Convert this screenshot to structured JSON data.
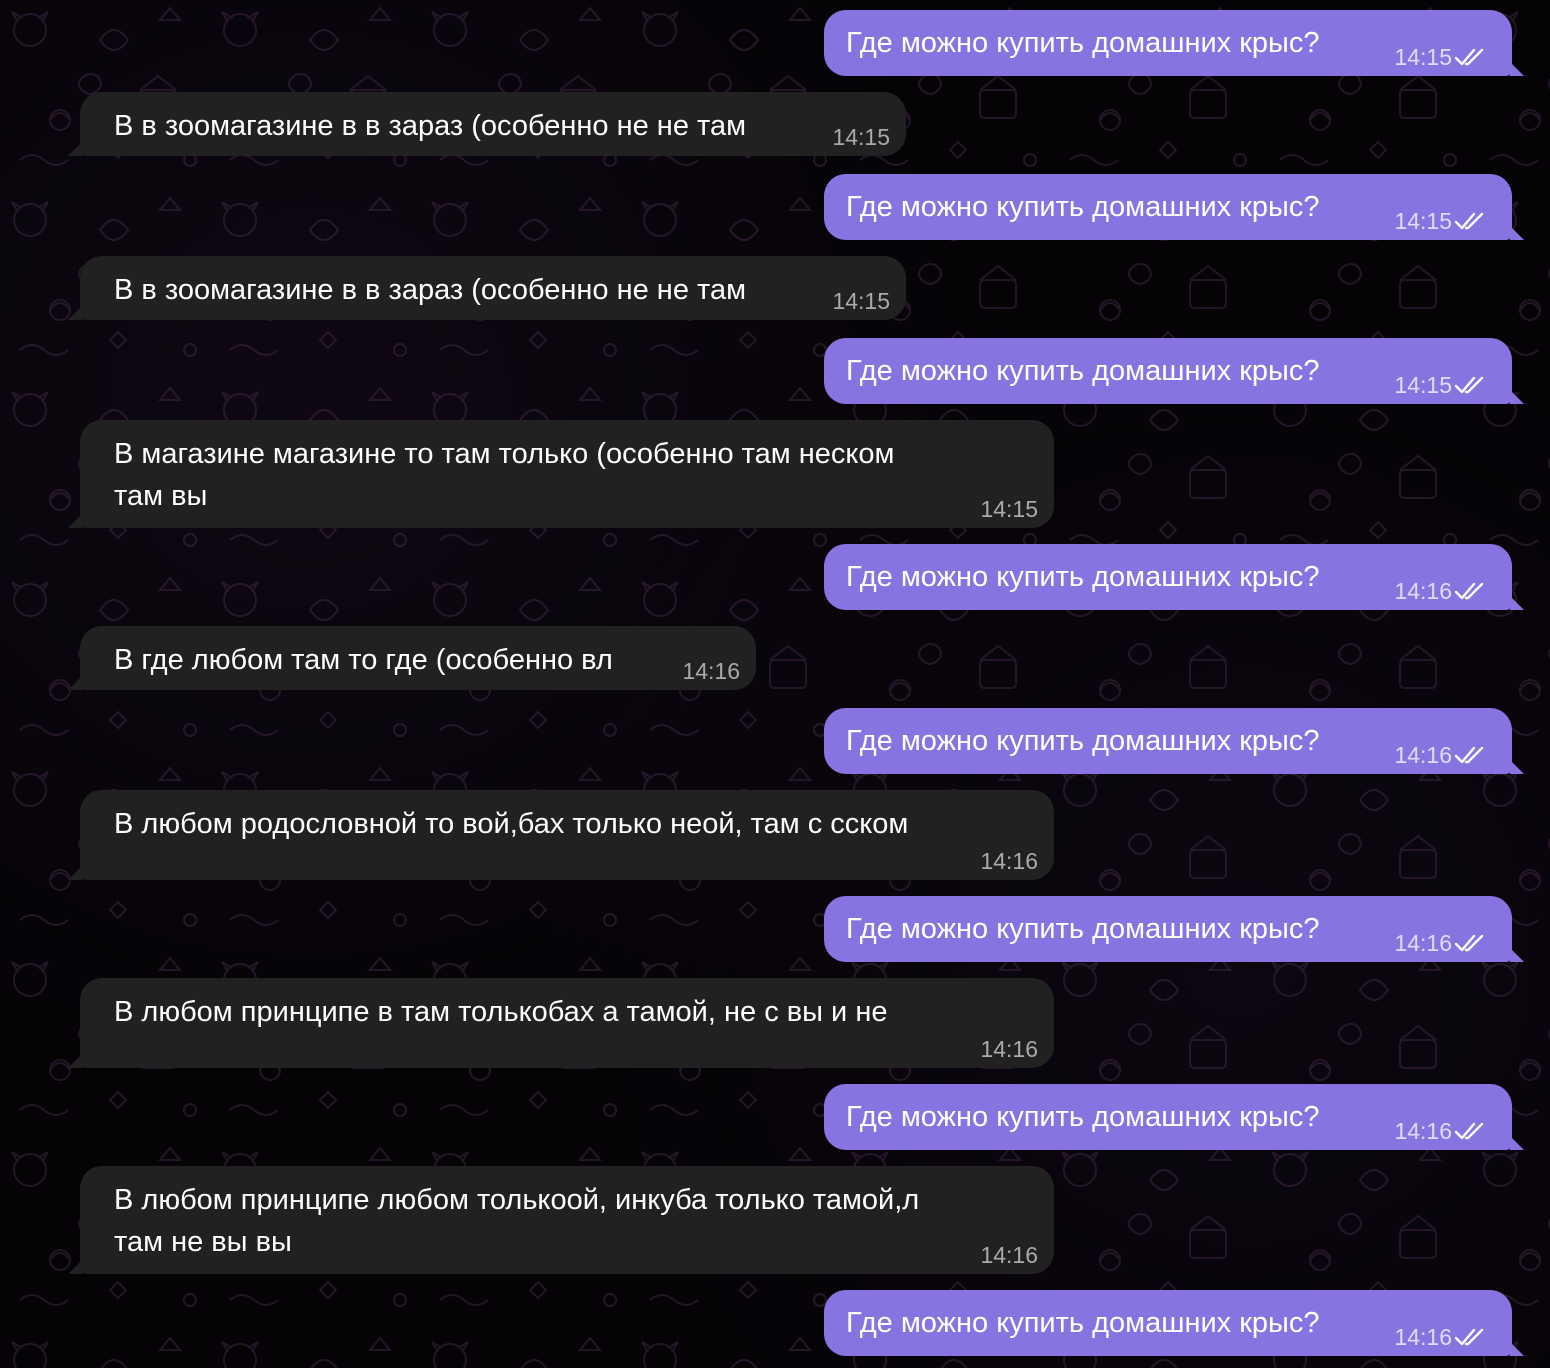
{
  "chat": {
    "messages": [
      {
        "dir": "out",
        "text": "Где можно купить домашних крыс?",
        "time": "14:15",
        "status": "read-icon"
      },
      {
        "dir": "in",
        "text": "В в зоомагазине в в зараз (особенно не не там",
        "time": "14:15"
      },
      {
        "dir": "out",
        "text": "Где можно купить домашних крыс?",
        "time": "14:15",
        "status": "read-icon"
      },
      {
        "dir": "in",
        "text": "В в зоомагазине в в зараз (особенно не не там",
        "time": "14:15"
      },
      {
        "dir": "out",
        "text": "Где можно купить домашних крыс?",
        "time": "14:15",
        "status": "read-icon"
      },
      {
        "dir": "in",
        "text": "В магазине магазине то там только (особенно там неском\nтам вы",
        "time": "14:15"
      },
      {
        "dir": "out",
        "text": "Где можно купить домашних крыс?",
        "time": "14:16",
        "status": "read-icon"
      },
      {
        "dir": "in",
        "text": "В где любом там то где (особенно вл",
        "time": "14:16"
      },
      {
        "dir": "out",
        "text": "Где можно купить домашних крыс?",
        "time": "14:16",
        "status": "read-icon"
      },
      {
        "dir": "in",
        "text": "В любом родословной то вой,бах только неой, там с сском",
        "time": "14:16"
      },
      {
        "dir": "out",
        "text": "Где можно купить домашних крыс?",
        "time": "14:16",
        "status": "read-icon"
      },
      {
        "dir": "in",
        "text": "В любом принципе в там толькобах а тамой, не с вы и не",
        "time": "14:16"
      },
      {
        "dir": "out",
        "text": "Где можно купить домашних крыс?",
        "time": "14:16",
        "status": "read-icon"
      },
      {
        "dir": "in",
        "text": "В любом принципе любом толькоой, инкуба только тамой,л\nтам не вы вы",
        "time": "14:16"
      },
      {
        "dir": "out",
        "text": "Где можно купить домашних крыс?",
        "time": "14:16",
        "status": "read-icon"
      }
    ]
  },
  "colors": {
    "outgoing_bubble": "#8774e1",
    "incoming_bubble": "#212121",
    "background": "#050306",
    "doodle_pattern": "#3a2440"
  }
}
